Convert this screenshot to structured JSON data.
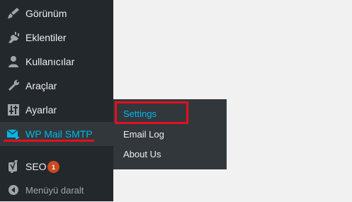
{
  "sidebar": {
    "items": [
      {
        "label": "Görünüm",
        "icon": "brush-icon"
      },
      {
        "label": "Eklentiler",
        "icon": "plugin-icon"
      },
      {
        "label": "Kullanıcılar",
        "icon": "users-icon"
      },
      {
        "label": "Araçlar",
        "icon": "wrench-icon"
      },
      {
        "label": "Ayarlar",
        "icon": "settings-sliders-icon"
      },
      {
        "label": "WP Mail SMTP",
        "icon": "mail-send-icon"
      },
      {
        "label": "SEO",
        "icon": "yoast-icon",
        "badge": "1"
      },
      {
        "label": "Menüyü daralt",
        "icon": "collapse-arrow-icon"
      }
    ]
  },
  "submenu": {
    "items": [
      {
        "label": "Settings"
      },
      {
        "label": "Email Log"
      },
      {
        "label": "About Us"
      }
    ]
  },
  "colors": {
    "sidebar_bg": "#23282d",
    "submenu_bg": "#32373c",
    "accent": "#00b9eb",
    "highlight_red": "#e3101d",
    "badge": "#ca4a1f"
  }
}
